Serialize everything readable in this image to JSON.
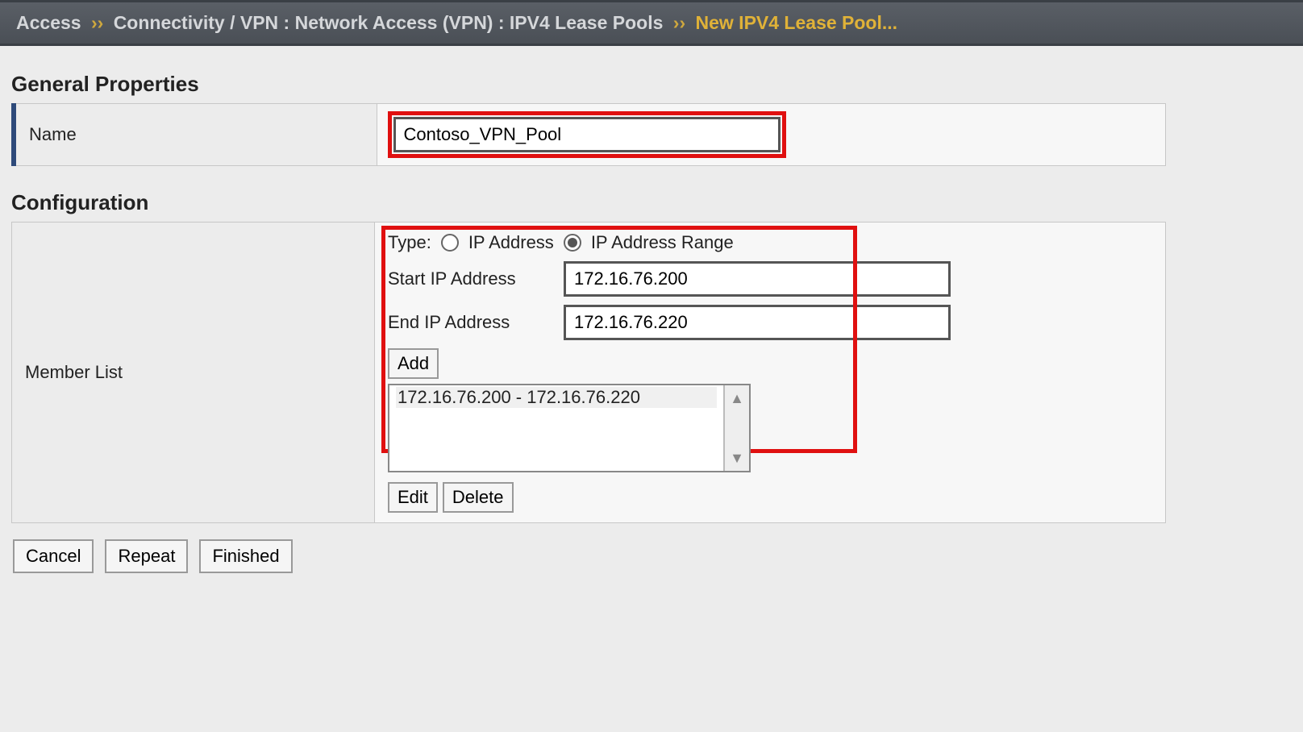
{
  "breadcrumb": {
    "part1": "Access",
    "part2": "Connectivity / VPN : Network Access (VPN) : IPV4 Lease Pools",
    "active": "New IPV4 Lease Pool..."
  },
  "sections": {
    "general_properties": "General Properties",
    "configuration": "Configuration"
  },
  "general": {
    "name_label": "Name",
    "name_value": "Contoso_VPN_Pool"
  },
  "config": {
    "member_list_label": "Member List",
    "type_label": "Type:",
    "radio_ip_address": "IP Address",
    "radio_ip_range": "IP Address Range",
    "type_selected": "range",
    "start_ip_label": "Start IP Address",
    "start_ip_value": "172.16.76.200",
    "end_ip_label": "End IP Address",
    "end_ip_value": "172.16.76.220",
    "add_label": "Add",
    "members": [
      "172.16.76.200 - 172.16.76.220"
    ],
    "edit_label": "Edit",
    "delete_label": "Delete"
  },
  "buttons": {
    "cancel": "Cancel",
    "repeat": "Repeat",
    "finished": "Finished"
  }
}
